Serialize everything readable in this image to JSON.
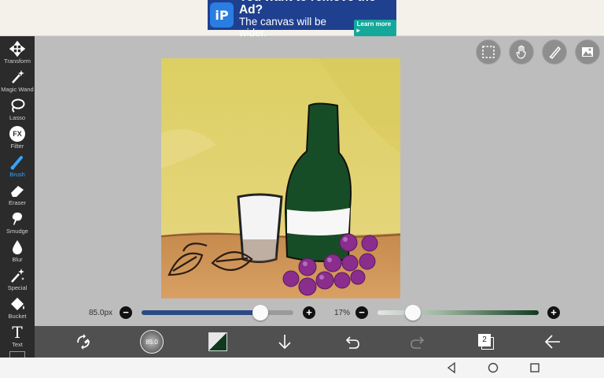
{
  "ad": {
    "headline": "You want to remove the Ad?",
    "subline": "The canvas will be wider.",
    "cta": "Learn more",
    "logo_text": "iP"
  },
  "toolbar": {
    "tools": [
      {
        "label": "Transform",
        "icon": "move-arrows-icon"
      },
      {
        "label": "Magic Wand",
        "icon": "magic-wand-icon"
      },
      {
        "label": "Lasso",
        "icon": "lasso-icon"
      },
      {
        "label": "Filter",
        "icon": "fx-icon"
      },
      {
        "label": "Brush",
        "icon": "brush-icon",
        "active": true
      },
      {
        "label": "Eraser",
        "icon": "eraser-icon"
      },
      {
        "label": "Smudge",
        "icon": "smudge-icon"
      },
      {
        "label": "Blur",
        "icon": "drop-icon"
      },
      {
        "label": "Special",
        "icon": "sparkle-wand-icon"
      },
      {
        "label": "Bucket",
        "icon": "bucket-icon"
      },
      {
        "label": "Text",
        "icon": "text-t-icon"
      }
    ],
    "filter_glyph": "FX",
    "text_glyph": "T"
  },
  "top_buttons": [
    "selection-icon",
    "hand-gesture-icon",
    "ruler-pencil-icon",
    "image-icon"
  ],
  "sliders": {
    "size": {
      "value_label": "85.0px",
      "fraction": 0.78,
      "minus": "−",
      "plus": "+"
    },
    "opacity": {
      "value_label": "17%",
      "fraction": 0.17,
      "minus": "−",
      "plus": "+"
    }
  },
  "bottom_bar": {
    "brush_preview_label": "85.0",
    "layer_count": "2",
    "items": [
      "swap-tools-icon",
      "brush-preview",
      "color-swatch",
      "download-arrow-icon",
      "undo-icon",
      "redo-icon",
      "layers-icon",
      "back-arrow-icon"
    ]
  },
  "colors": {
    "accent_blue": "#34a3ff",
    "size_track": "#2b4a83",
    "swatch_color": "#0f3a1f"
  },
  "nav": [
    "back-triangle-icon",
    "home-circle-icon",
    "recents-square-icon"
  ]
}
